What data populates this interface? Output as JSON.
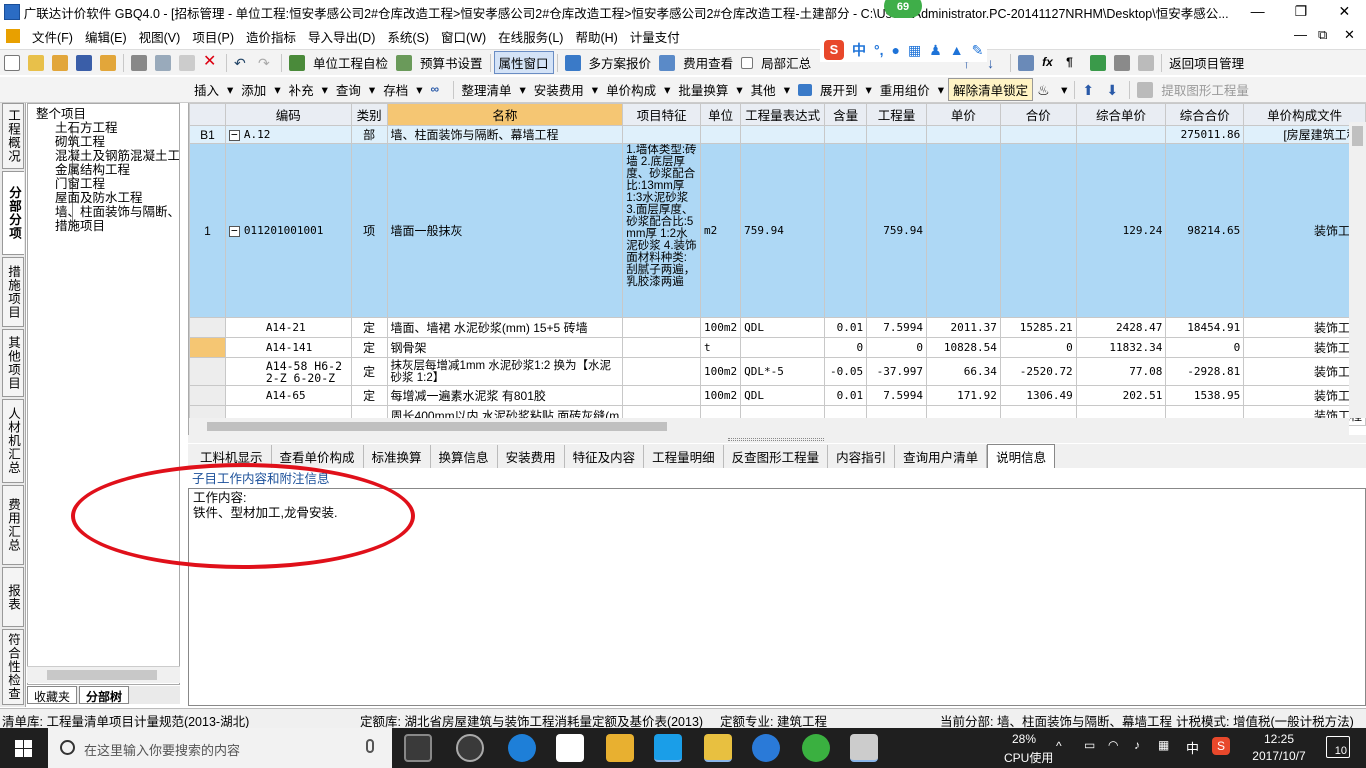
{
  "window": {
    "title": "广联达计价软件 GBQ4.0 - [招标管理 - 单位工程:恒安孝感公司2#仓库改造工程>恒安孝感公司2#仓库改造工程>恒安孝感公司2#仓库改造工程-土建部分 - C:\\Users\\Administrator.PC-20141127NRHM\\Desktop\\恒安孝感公...",
    "notification_badge": "69",
    "min_label": "—",
    "max_label": "❐",
    "close_label": "✕"
  },
  "menu": {
    "items": [
      "文件(F)",
      "编辑(E)",
      "视图(V)",
      "项目(P)",
      "造价指标",
      "导入导出(D)",
      "系统(S)",
      "窗口(W)",
      "在线服务(L)",
      "帮助(H)",
      "计量支付"
    ],
    "right_min": "—",
    "right_restore": "⧉",
    "right_close": "✕"
  },
  "toolbar1": {
    "check_label": "单位工程自检",
    "budget_label": "预算书设置",
    "property_label": "属性窗口",
    "multi_quote_label": "多方案报价",
    "fee_view_label": "费用查看",
    "partial_summary_label": "局部汇总",
    "return_label": "返回项目管理"
  },
  "toolbar2": {
    "items": [
      "插入",
      "添加",
      "补充",
      "查询",
      "存档"
    ],
    "tidy_label": "整理清单",
    "install_fee_label": "安装费用",
    "price_comp_label": "单价构成",
    "batch_label": "批量换算",
    "other_label": "其他",
    "expand_label": "展开到",
    "reuse_label": "重用组价",
    "unlock_label": "解除清单锁定",
    "extract_label": "提取图形工程量"
  },
  "ime": {
    "logo": "S",
    "lang": "中",
    "punct": "°,"
  },
  "left_tabs": [
    "工程概况",
    "分部分项",
    "措施项目",
    "其他项目",
    "人材机汇总",
    "费用汇总",
    "报表",
    "符合性检查"
  ],
  "tree": {
    "root": "整个项目",
    "items": [
      "土石方工程",
      "砌筑工程",
      "混凝土及钢筋混凝土工程",
      "金属结构工程",
      "门窗工程",
      "屋面及防水工程",
      "墙、柱面装饰与隔断、幕墙工程",
      "措施项目"
    ],
    "tabs": [
      "收藏夹",
      "分部树"
    ]
  },
  "grid": {
    "columns": [
      "",
      "编码",
      "类别",
      "名称",
      "项目特征",
      "单位",
      "工程量表达式",
      "含量",
      "工程量",
      "单价",
      "合价",
      "综合单价",
      "综合合价",
      "单价构成文件"
    ],
    "rows": [
      {
        "rn": "B1",
        "code": "A.12",
        "type": "部",
        "name": "墙、柱面装饰与隔断、幕墙工程",
        "feature": "",
        "unit": "",
        "expr": "",
        "content": "",
        "qty": "",
        "price": "",
        "total": "",
        "comp_price": "",
        "comp_total": "275011.86",
        "file": "[房屋建筑工程]"
      },
      {
        "rn": "1",
        "code": "011201001001",
        "type": "项",
        "name": "墙面一般抹灰",
        "feature": "1.墙体类型:砖墙 2.底层厚度、砂浆配合比:13mm厚 1:3水泥砂浆 3.面层厚度、砂浆配合比:5mm厚 1:2水泥砂浆 4.装饰面材料种类:刮腻子两遍，乳胶漆两遍",
        "unit": "m2",
        "expr": "759.94",
        "content": "",
        "qty": "759.94",
        "price": "",
        "total": "",
        "comp_price": "129.24",
        "comp_total": "98214.65",
        "file": "装饰工程"
      },
      {
        "rn": "",
        "code": "A14-21",
        "type": "定",
        "name": "墙面、墙裙 水泥砂浆(mm) 15+5 砖墙",
        "feature": "",
        "unit": "100m2",
        "expr": "QDL",
        "content": "0.01",
        "qty": "7.5994",
        "price": "2011.37",
        "total": "15285.21",
        "comp_price": "2428.47",
        "comp_total": "18454.91",
        "file": "装饰工程"
      },
      {
        "rn": "",
        "code": "A14-141",
        "type": "定",
        "name": "钢骨架",
        "feature": "",
        "unit": "t",
        "expr": "",
        "content": "0",
        "qty": "0",
        "price": "10828.54",
        "total": "0",
        "comp_price": "11832.34",
        "comp_total": "0",
        "file": "装饰工程"
      },
      {
        "rn": "",
        "code": "A14-58 H6-22-Z 6-20-Z",
        "type": "定",
        "name": "抹灰层每增减1mm 水泥砂浆1:2 换为【水泥砂浆 1:2】",
        "feature": "",
        "unit": "100m2",
        "expr": "QDL*-5",
        "content": "-0.05",
        "qty": "-37.997",
        "price": "66.34",
        "total": "-2520.72",
        "comp_price": "77.08",
        "comp_total": "-2928.81",
        "file": "装饰工程"
      },
      {
        "rn": "",
        "code": "A14-65",
        "type": "定",
        "name": "每增减一遍素水泥浆 有801胶",
        "feature": "",
        "unit": "100m2",
        "expr": "QDL",
        "content": "0.01",
        "qty": "7.5994",
        "price": "171.92",
        "total": "1306.49",
        "comp_price": "202.51",
        "comp_total": "1538.95",
        "file": "装饰工程"
      },
      {
        "rn": "",
        "code": "",
        "type": "",
        "name": "周长400mm以内 水泥砂浆粘贴 面砖灰缝(m",
        "feature": "",
        "unit": "",
        "expr": "",
        "content": "",
        "qty": "",
        "price": "",
        "total": "",
        "comp_price": "",
        "comp_total": "",
        "file": "装饰工程"
      }
    ]
  },
  "bottom_tabs": [
    "工料机显示",
    "查看单价构成",
    "标准换算",
    "换算信息",
    "安装费用",
    "特征及内容",
    "工程量明细",
    "反查图形工程量",
    "内容指引",
    "查询用户清单",
    "说明信息"
  ],
  "info": {
    "header": "子目工作内容和附注信息",
    "line1": "工作内容:",
    "line2": "铁件、型材加工,龙骨安装."
  },
  "status": {
    "list_lib": "清单库:  工程量清单项目计量规范(2013-湖北)",
    "quota_lib": "定额库:  湖北省房屋建筑与装饰工程消耗量定额及基价表(2013)",
    "quota_major": "定额专业:  建筑工程",
    "current_part": "当前分部:  墙、柱面装饰与隔断、幕墙工程",
    "tax_mode": "计税模式:  增值税(一般计税方法)"
  },
  "taskbar": {
    "search_placeholder": "在这里输入你要搜索的内容",
    "cpu_percent": "28%",
    "cpu_label": "CPU使用",
    "ime_lang": "中",
    "time": "12:25",
    "date": "2017/10/7",
    "notification_count": "10"
  },
  "colors": {
    "selected_row": "#aed8f5",
    "header_highlight": "#f5c673",
    "annotation_circle": "#e0101a",
    "taskbar_bg": "#1f1f1f"
  }
}
